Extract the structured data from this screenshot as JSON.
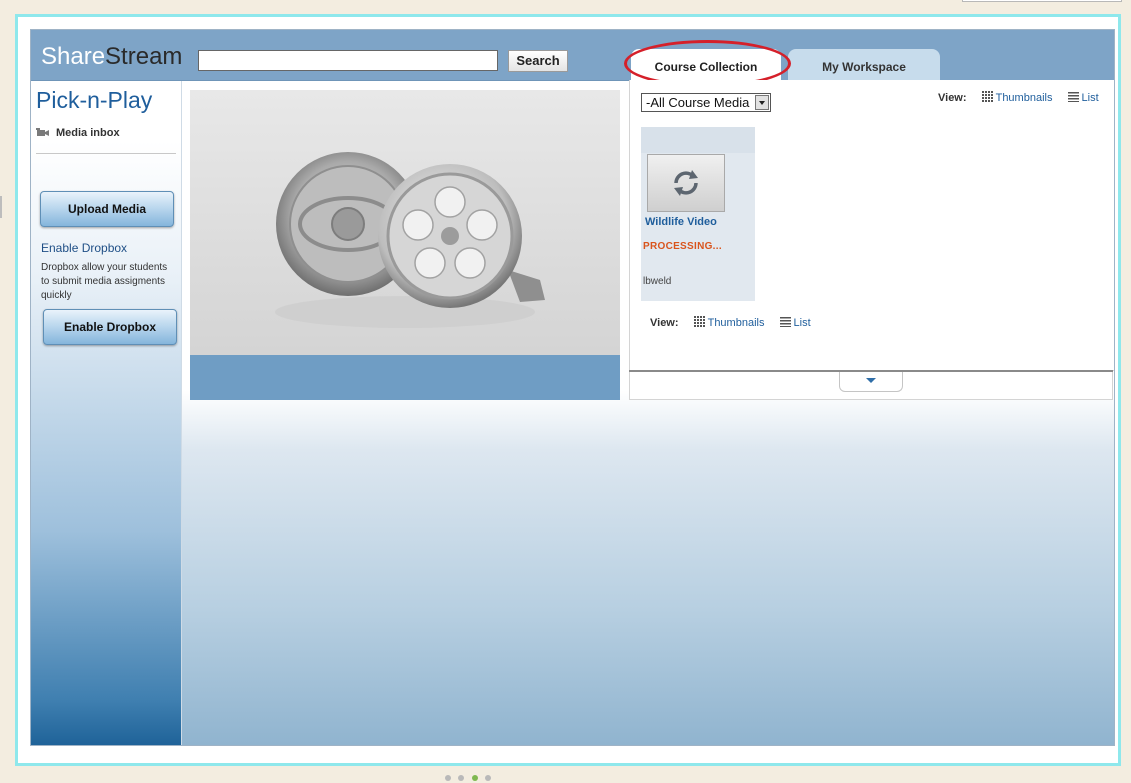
{
  "header": {
    "logo_share": "Share",
    "logo_stream": "Stream",
    "search_value": "",
    "search_button": "Search"
  },
  "tabs": [
    {
      "label": "Course Collection",
      "active": true,
      "highlighted": true
    },
    {
      "label": "My Workspace",
      "active": false
    }
  ],
  "sidebar": {
    "title": "Pick-n-Play",
    "media_inbox": "Media inbox",
    "upload_button": "Upload Media",
    "enable_dropbox_link": "Enable Dropbox",
    "dropbox_description": "Dropbox allow your students to submit media assigments quickly",
    "enable_dropbox_button": "Enable Dropbox"
  },
  "collection": {
    "filter_selected": "-All Course Media",
    "view_label": "View:",
    "view_thumbnails": "Thumbnails",
    "view_list": "List",
    "items": [
      {
        "title": "Wildlife Video",
        "status": "PROCESSING...",
        "owner": "lbweld"
      }
    ]
  },
  "colors": {
    "header_bg": "#7ea4c7",
    "link_blue": "#1f5e9c",
    "processing_orange": "#d9541c",
    "highlight_red": "#d5202a",
    "frame_cyan": "#8ee8ec"
  },
  "icons": {
    "media_inbox": "camera-icon",
    "thumbnails": "grid-icon",
    "list": "list-icon",
    "processing": "refresh-icon",
    "collapse": "chevron-down-icon",
    "player_art": "film-reel-icon"
  }
}
